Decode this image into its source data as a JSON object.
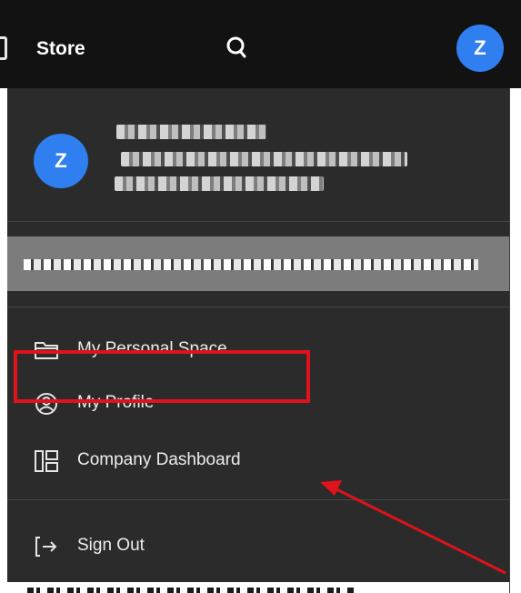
{
  "topbar": {
    "store_label": "Store",
    "avatar_letter": "Z",
    "icons": [
      "store-icon",
      "search-icon"
    ]
  },
  "user": {
    "avatar_letter": "Z"
  },
  "menu": {
    "items": [
      {
        "label": "My Personal Space",
        "icon": "folder-icon"
      },
      {
        "label": "My Profile",
        "icon": "user-circle-icon"
      },
      {
        "label": "Company Dashboard",
        "icon": "dashboard-icon"
      },
      {
        "label": "Sign Out",
        "icon": "sign-out-icon"
      }
    ]
  },
  "annotation": {
    "highlight_color": "#e0121b",
    "arrow_color": "#e0121b"
  },
  "colors": {
    "topbar_bg": "#121212",
    "menu_bg": "#2b2b2b",
    "avatar_bg": "#2f7ff0",
    "selected_row_bg": "#7c7c7c"
  }
}
